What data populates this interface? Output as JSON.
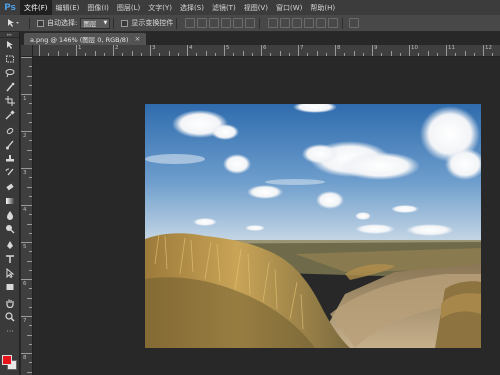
{
  "app": {
    "logo": "Ps"
  },
  "menu": {
    "items": [
      {
        "label": "文件(F)",
        "active": true
      },
      {
        "label": "编辑(E)"
      },
      {
        "label": "图像(I)"
      },
      {
        "label": "图层(L)"
      },
      {
        "label": "文字(Y)"
      },
      {
        "label": "选择(S)"
      },
      {
        "label": "滤镜(T)"
      },
      {
        "label": "视图(V)"
      },
      {
        "label": "窗口(W)"
      },
      {
        "label": "帮助(H)"
      }
    ]
  },
  "options": {
    "auto_select_label": "自动选择:",
    "auto_select_value": "图层",
    "show_transform_label": "显示变换控件"
  },
  "document": {
    "tab_title": "a.png @ 146% (图层 0, RGB/8)",
    "close_glyph": "×"
  },
  "rulers": {
    "h_labels": [
      "1",
      "2",
      "3",
      "4",
      "5",
      "6",
      "7",
      "8",
      "9",
      "10",
      "11",
      "12"
    ],
    "v_labels": [
      "1",
      "2",
      "3",
      "4",
      "5",
      "6",
      "7",
      "8"
    ]
  },
  "colors": {
    "foreground": "#e8141c",
    "background": "#e8e8e8"
  },
  "tools": [
    "move-tool-icon",
    "marquee-tool-icon",
    "lasso-tool-icon",
    "quick-select-tool-icon",
    "crop-tool-icon",
    "eyedropper-tool-icon",
    "spot-heal-tool-icon",
    "brush-tool-icon",
    "clone-stamp-tool-icon",
    "history-brush-tool-icon",
    "eraser-tool-icon",
    "gradient-tool-icon",
    "blur-tool-icon",
    "dodge-tool-icon",
    "pen-tool-icon",
    "type-tool-icon",
    "path-select-tool-icon",
    "shape-tool-icon",
    "hand-tool-icon",
    "zoom-tool-icon"
  ]
}
